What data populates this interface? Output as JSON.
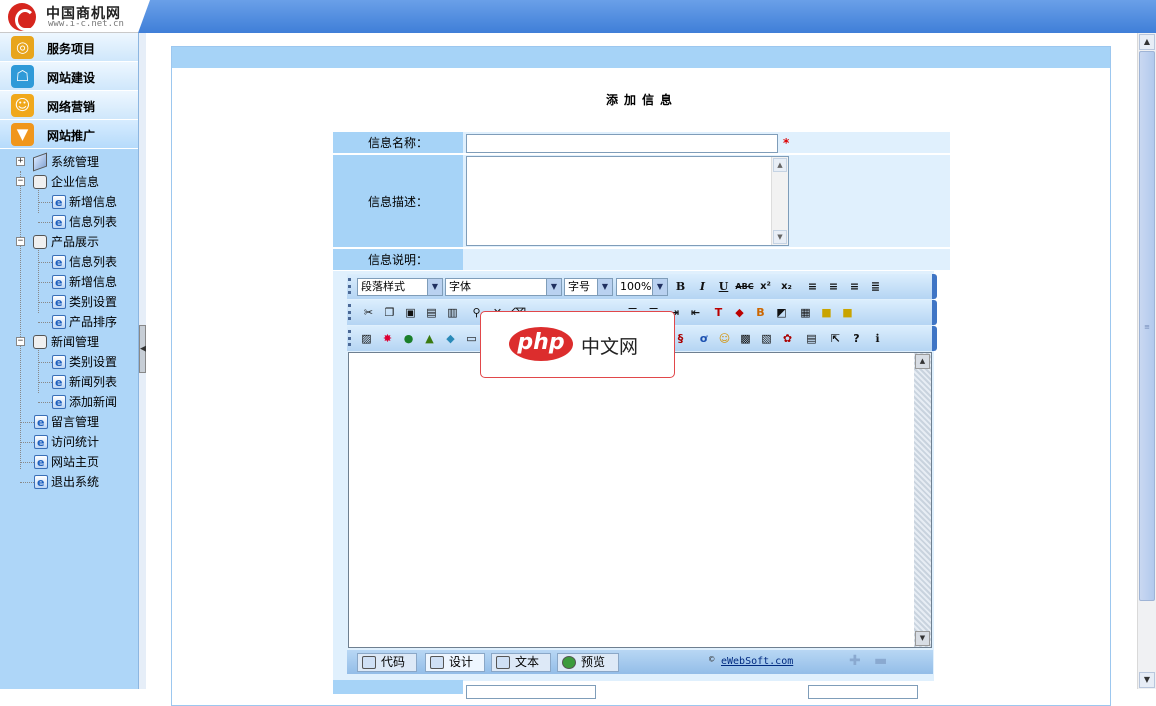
{
  "brand": {
    "name": "中国商机网",
    "url": "www.i-c.net.cn"
  },
  "nav": [
    {
      "label": "服务项目",
      "icon": "target-icon",
      "color": "#e8a51c"
    },
    {
      "label": "网站建设",
      "icon": "gamepad-icon",
      "color": "#2f9ad8"
    },
    {
      "label": "网络营销",
      "icon": "smiley-icon",
      "color": "#f0a81c"
    },
    {
      "label": "网站推广",
      "icon": "graduation-cap-icon",
      "color": "#f0961c"
    }
  ],
  "tree": {
    "system": "系统管理",
    "company": "企业信息",
    "company_children": [
      "新增信息",
      "信息列表"
    ],
    "products": "产品展示",
    "products_children": [
      "信息列表",
      "新增信息",
      "类别设置",
      "产品排序"
    ],
    "news": "新闻管理",
    "news_children": [
      "类别设置",
      "新闻列表",
      "添加新闻"
    ],
    "root_items": [
      "留言管理",
      "访问统计",
      "网站主页",
      "退出系统"
    ]
  },
  "page_title": "添加信息",
  "form": {
    "name_label": "信息名称：",
    "name_value": "",
    "required_mark": "*",
    "desc_label": "信息描述：",
    "desc_value": "",
    "note_label": "信息说明："
  },
  "editor": {
    "style_select": "段落样式",
    "font_select": "字体",
    "size_select": "字号",
    "zoom_select": "100%",
    "modes": {
      "code": "代码",
      "design": "设计",
      "text": "文本",
      "preview": "预览"
    },
    "credit": "eWebSoft.com"
  },
  "watermark": {
    "pill": "php",
    "text": "中文网"
  }
}
